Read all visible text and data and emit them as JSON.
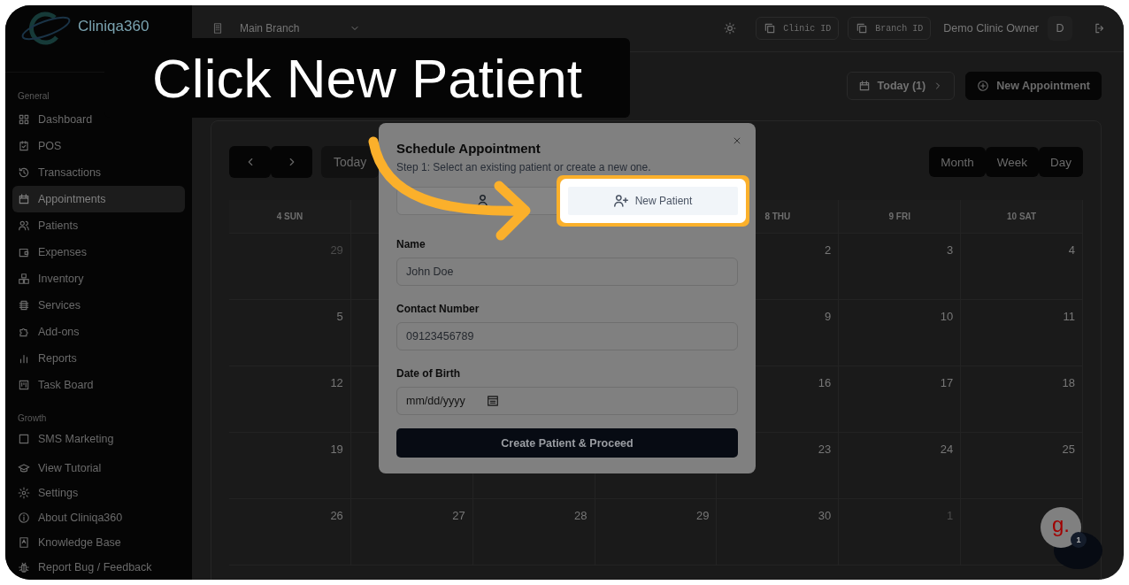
{
  "tutorial": {
    "caption": "Click New Patient"
  },
  "sidebar": {
    "brand": "Cliniqa360",
    "sections": [
      {
        "heading": "General",
        "items": [
          {
            "label": "Dashboard",
            "selected": false
          },
          {
            "label": "POS",
            "selected": false
          },
          {
            "label": "Transactions",
            "selected": false
          },
          {
            "label": "Appointments",
            "selected": true
          },
          {
            "label": "Patients",
            "selected": false
          },
          {
            "label": "Expenses",
            "selected": false
          },
          {
            "label": "Inventory",
            "selected": false
          },
          {
            "label": "Services",
            "selected": false
          },
          {
            "label": "Add-ons",
            "selected": false
          },
          {
            "label": "Reports",
            "selected": false
          },
          {
            "label": "Task Board",
            "selected": false
          }
        ]
      },
      {
        "heading": "Growth",
        "items": [
          {
            "label": "SMS Marketing",
            "selected": false
          }
        ]
      }
    ],
    "footer_items": [
      "View Tutorial",
      "Settings",
      "About Cliniqa360",
      "Knowledge Base",
      "Report Bug / Feedback"
    ]
  },
  "topbar": {
    "branch_select": "Main Branch",
    "id_buttons": [
      "Clinic ID",
      "Branch ID"
    ],
    "user_name": "Demo Clinic Owner",
    "avatar": "D"
  },
  "page_actions": [
    {
      "label": "Today (1)",
      "kind": "today"
    },
    {
      "label": "New Appointment",
      "kind": "primary"
    }
  ],
  "calendar": {
    "today_button": "Today",
    "views": [
      "Month",
      "Week",
      "Day"
    ],
    "headers_left": [
      "4 SUN"
    ],
    "headers_right": [
      "8 THU",
      "9 FRI",
      "10 SAT"
    ],
    "rows": [
      {
        "left": [
          {
            "date": "29",
            "outside_month": true
          }
        ],
        "right": [
          {
            "date": "2",
            "outside_month": false
          },
          {
            "date": "3",
            "outside_month": false
          },
          {
            "date": "4",
            "outside_month": false
          }
        ]
      },
      {
        "left": [
          {
            "date": "5",
            "outside_month": false
          }
        ],
        "right": [
          {
            "date": "9",
            "outside_month": false
          },
          {
            "date": "10",
            "outside_month": false
          },
          {
            "date": "11",
            "outside_month": false
          }
        ]
      },
      {
        "left": [
          {
            "date": "12",
            "outside_month": false
          }
        ],
        "right": [
          {
            "date": "16",
            "outside_month": false
          },
          {
            "date": "17",
            "outside_month": false
          },
          {
            "date": "18",
            "outside_month": false
          }
        ]
      },
      {
        "left": [
          {
            "date": "19",
            "outside_month": false
          }
        ],
        "right": [
          {
            "date": "23",
            "outside_month": false
          },
          {
            "date": "24",
            "outside_month": false
          },
          {
            "date": "25",
            "outside_month": false
          }
        ]
      },
      {
        "left": [
          {
            "date": "26",
            "outside_month": false
          },
          {
            "date": "27",
            "outside_month": false
          },
          {
            "date": "28",
            "outside_month": false
          },
          {
            "date": "29",
            "outside_month": false
          },
          {
            "date": "30",
            "outside_month": false
          },
          {
            "date": "1",
            "outside_month": true
          }
        ]
      }
    ]
  },
  "modal": {
    "title": "Schedule Appointment",
    "subtitle": "Step 1: Select an existing patient or create a new one.",
    "tabs": [
      {
        "selected": true
      },
      {
        "label": "New Patient",
        "selected": false
      }
    ],
    "fields": [
      {
        "label": "Name",
        "placeholder": "John Doe",
        "kind": "text"
      },
      {
        "label": "Contact Number",
        "placeholder": "09123456789",
        "kind": "text"
      },
      {
        "label": "Date of Birth",
        "placeholder": "mm/dd/yyyy",
        "kind": "date"
      }
    ],
    "submit": "Create Patient & Proceed"
  },
  "chat": {
    "logo": "g.",
    "badge": "1"
  }
}
